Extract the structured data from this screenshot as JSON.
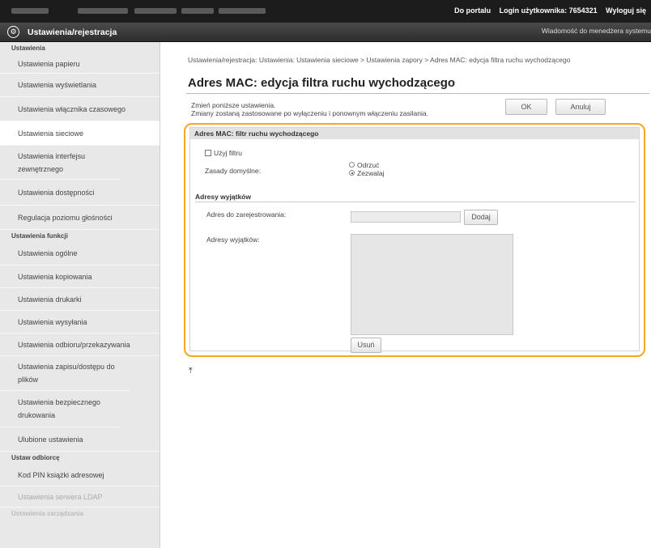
{
  "topbar": {
    "links": [
      "Do portalu",
      "Login użytkownika: 7654321",
      "Wyloguj się"
    ]
  },
  "titlebar": {
    "icon": "gear-icon",
    "title": "Ustawienia/rejestracja",
    "message_link": "Wiadomość do menedżera systemu"
  },
  "sidebar": {
    "sections": [
      {
        "title": "Ustawienia",
        "items": [
          "Ustawienia papieru",
          "Ustawienia wyświetlania",
          "Ustawienia włącznika czasowego",
          "Ustawienia sieciowe",
          "Ustawienia interfejsu zewnętrznego",
          "Ustawienia dostępności",
          "Regulacja poziomu głośności"
        ],
        "active_index": 3
      },
      {
        "title": "Ustawienia funkcji",
        "items": [
          "Ustawienia ogólne",
          "Ustawienia kopiowania",
          "Ustawienia drukarki",
          "Ustawienia wysyłania",
          "Ustawienia odbioru/przekazywania",
          "Ustawienia zapisu/dostępu do plików",
          "Ustawienia bezpiecznego drukowania",
          "Ulubione ustawienia"
        ]
      },
      {
        "title": "Ustaw odbiorcę",
        "items": [
          "Kod PIN książki adresowej",
          "Ustawienia serwera LDAP"
        ]
      },
      {
        "title": "Ustawienia zarządzania",
        "items": []
      }
    ]
  },
  "main": {
    "breadcrumb": "Ustawienia/rejestracja: Ustawienia: Ustawienia sieciowe > Ustawienia zapory > Adres MAC: edycja filtra ruchu wychodzącego",
    "title": "Adres MAC: edycja filtra ruchu wychodzącego",
    "instructions": [
      "Zmień poniższe ustawienia.",
      "Zmiany zostaną zastosowane po wyłączeniu i ponownym włączeniu zasilania."
    ],
    "ok_label": "OK",
    "cancel_label": "Anuluj",
    "panel": {
      "title": "Adres MAC: filtr ruchu wychodzącego",
      "use_filter_label": "Użyj filtru",
      "use_filter_checked": false,
      "default_policy_label": "Zasady domyślne:",
      "policy_options": [
        "Odrzuć",
        "Zezwalaj"
      ],
      "policy_selected": "Zezwalaj",
      "exceptions_heading": "Adresy wyjątków",
      "register_label": "Adres do zarejestrowania:",
      "register_value": "",
      "add_label": "Dodaj",
      "exceptions_label": "Adresy wyjątków:",
      "exceptions_list": [],
      "delete_label": "Usuń"
    },
    "top_link_icon": "scroll-to-top-icon",
    "highlight_color": "#f5a623"
  }
}
